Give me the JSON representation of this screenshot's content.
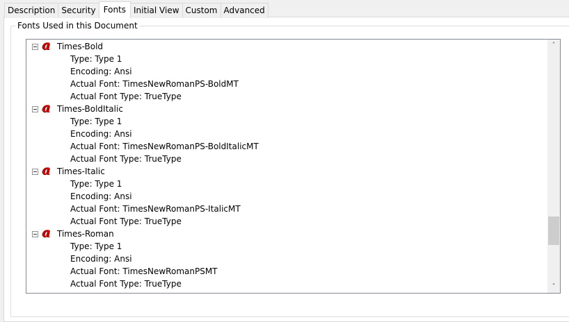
{
  "tabs": [
    {
      "label": "Description"
    },
    {
      "label": "Security"
    },
    {
      "label": "Fonts",
      "active": true
    },
    {
      "label": "Initial View"
    },
    {
      "label": "Custom"
    },
    {
      "label": "Advanced"
    }
  ],
  "group_title": "Fonts Used in this Document",
  "fonts": [
    {
      "name": "Times-Bold",
      "props": [
        "Type: Type 1",
        "Encoding: Ansi",
        "Actual Font: TimesNewRomanPS-BoldMT",
        "Actual Font Type: TrueType"
      ]
    },
    {
      "name": "Times-BoldItalic",
      "props": [
        "Type: Type 1",
        "Encoding: Ansi",
        "Actual Font: TimesNewRomanPS-BoldItalicMT",
        "Actual Font Type: TrueType"
      ]
    },
    {
      "name": "Times-Italic",
      "props": [
        "Type: Type 1",
        "Encoding: Ansi",
        "Actual Font: TimesNewRomanPS-ItalicMT",
        "Actual Font Type: TrueType"
      ]
    },
    {
      "name": "Times-Roman",
      "props": [
        "Type: Type 1",
        "Encoding: Ansi",
        "Actual Font: TimesNewRomanPSMT",
        "Actual Font Type: TrueType"
      ]
    }
  ],
  "scroll_position": 0.72,
  "icons": {
    "font": "font-type1-icon",
    "expand": "collapse-icon"
  }
}
